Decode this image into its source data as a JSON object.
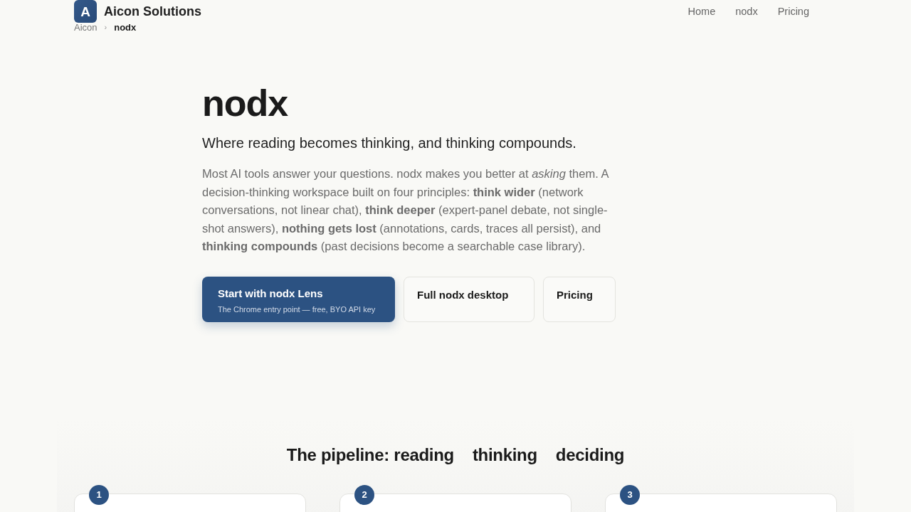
{
  "header": {
    "logo_letter": "A",
    "brand": "Aicon Solutions",
    "nav": [
      {
        "label": "Home"
      },
      {
        "label": "nodx"
      },
      {
        "label": "Pricing"
      }
    ]
  },
  "breadcrumb": {
    "separator": "›",
    "items": [
      {
        "label": "Aicon",
        "current": false
      },
      {
        "label": "nodx",
        "current": true
      }
    ]
  },
  "hero": {
    "title": "nodx",
    "tagline": "Where reading becomes thinking, and thinking compounds.",
    "description": "Most AI tools answer your questions. nodx makes you better at *asking* them. A decision-thinking workspace built on four principles: **think wider** (network conversations, not linear chat), **think deeper** (expert-panel debate, not single-shot answers), **nothing gets lost** (annotations, cards, traces all persist), and **thinking compounds** (past decisions become a searchable case library).",
    "actions": [
      {
        "kind": "primary",
        "label": "Start with nodx Lens",
        "caption": "The Chrome entry point — free, BYO API key"
      },
      {
        "kind": "secondary",
        "label": "Full nodx desktop"
      },
      {
        "kind": "secondary",
        "label": "Pricing"
      }
    ]
  },
  "pipeline": {
    "heading": [
      "The pipeline: reading",
      "thinking",
      "deciding"
    ],
    "steps": [
      {
        "number": "1"
      },
      {
        "number": "2"
      },
      {
        "number": "3"
      }
    ]
  }
}
